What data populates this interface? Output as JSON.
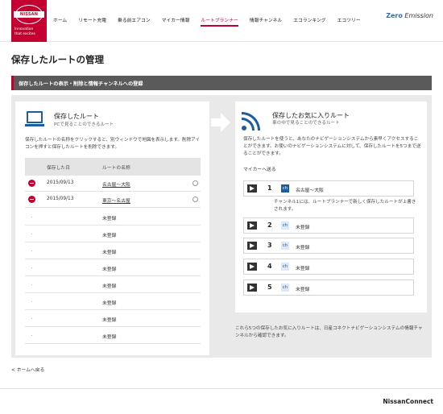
{
  "header": {
    "logo_text": "NISSAN",
    "tagline": [
      "Innovation",
      "that excites"
    ],
    "nav": [
      "ホーム",
      "リモート充電",
      "乗る前エアコン",
      "マイカー情報",
      "ルートプランナー",
      "情報チャンネル",
      "エコランキング",
      "エコツリー"
    ],
    "active_nav": "ルートプランナー",
    "zero_emission_mark": "Zero",
    "zero_emission": "Emission"
  },
  "page": {
    "title": "保存したルートの管理",
    "section_title": "保存したルートの表示・削除と情報チャンネルへの登録"
  },
  "saved_routes": {
    "title": "保存したルート",
    "subtitle": "PCで見ることのできるルート",
    "description": "保存したルートの名称をクリックすると、別ウィンドウで地図を表示します。削除アイコンを押すと保存したルートを削除できます。",
    "columns": [
      "保存した日",
      "ルートの名称"
    ],
    "rows": [
      {
        "date": "2015/09/13",
        "name": "名古屋〜大阪",
        "deletable": true
      },
      {
        "date": "2015/09/13",
        "name": "東京〜名古屋",
        "deletable": true
      },
      {
        "date": "",
        "name": "未登録",
        "deletable": false
      },
      {
        "date": "",
        "name": "未登録",
        "deletable": false
      },
      {
        "date": "",
        "name": "未登録",
        "deletable": false
      },
      {
        "date": "",
        "name": "未登録",
        "deletable": false
      },
      {
        "date": "",
        "name": "未登録",
        "deletable": false
      },
      {
        "date": "",
        "name": "未登録",
        "deletable": false
      },
      {
        "date": "",
        "name": "未登録",
        "deletable": false
      },
      {
        "date": "",
        "name": "未登録",
        "deletable": false
      }
    ]
  },
  "favorites": {
    "title": "保存したお気に入りルート",
    "subtitle": "車の中で見ることのできるルート",
    "description": "保存したルートを使うと、あなたのナビゲーションシステムから素早くアクセスすることができます。お使いのナビゲーションシステムに対して、保存したルートを5つまで送ることができます。",
    "send_label": "マイカーへ送る",
    "ch_label": "ch",
    "items": [
      {
        "number": "1",
        "route": "名古屋〜大阪"
      },
      {
        "number": "2",
        "route": "未登録"
      },
      {
        "number": "3",
        "route": "未登録"
      },
      {
        "number": "4",
        "route": "未登録"
      },
      {
        "number": "5",
        "route": "未登録"
      }
    ],
    "note": "チャンネル1には、ルートプランナーで新しく保存したルートが上書きされます。",
    "footer_note": "これら5つの保存したお気に入りルートは、日産コネクトナビゲーションシステムの情報チャンネルから確認できます。"
  },
  "home_link": "< ホームへ戻る",
  "footer_brand": "NissanConnect",
  "colors": {
    "accent": "#c3002f",
    "icon_blue": "#1c5ca0",
    "section_bar": "#5a5a5a",
    "panel_bg": "#e9e9e9"
  }
}
